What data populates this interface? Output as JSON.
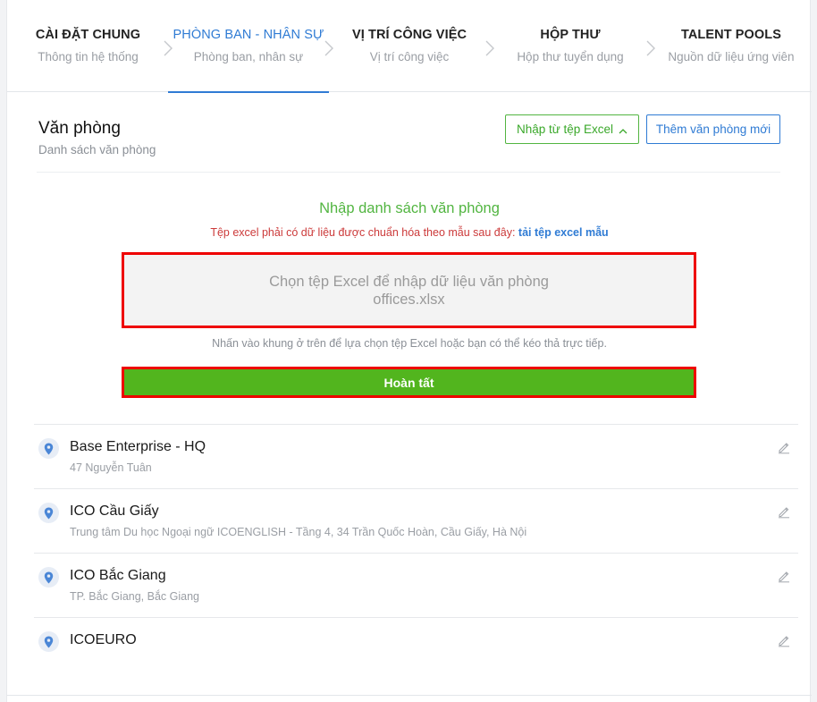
{
  "steps": [
    {
      "title": "CÀI ĐẶT CHUNG",
      "subtitle": "Thông tin hệ thống",
      "active": false
    },
    {
      "title": "PHÒNG BAN - NHÂN SỰ",
      "subtitle": "Phòng ban, nhân sự",
      "active": true
    },
    {
      "title": "VỊ TRÍ CÔNG VIỆC",
      "subtitle": "Vị trí công việc",
      "active": false
    },
    {
      "title": "HỘP THƯ",
      "subtitle": "Hộp thư tuyển dụng",
      "active": false
    },
    {
      "title": "TALENT POOLS",
      "subtitle": "Nguồn dữ liệu ứng viên",
      "active": false
    }
  ],
  "header": {
    "title": "Văn phòng",
    "subtitle": "Danh sách văn phòng",
    "import_label": "Nhập từ tệp Excel",
    "add_label": "Thêm văn phòng mới"
  },
  "import_panel": {
    "title": "Nhập danh sách văn phòng",
    "note": "Tệp excel phải có dữ liệu được chuẩn hóa theo mẫu sau đây:",
    "template_link": "tải tệp excel mẫu",
    "dropzone_text": "Chọn tệp Excel để nhập dữ liệu văn phòng",
    "file_name": "offices.xlsx",
    "hint": "Nhấn vào khung ở trên để lựa chọn tệp Excel hoặc bạn có thể kéo thả trực tiếp.",
    "done_label": "Hoàn tất"
  },
  "offices": [
    {
      "name": "Base Enterprise - HQ",
      "address": "47 Nguyễn Tuân"
    },
    {
      "name": "ICO Cầu Giấy",
      "address": "Trung tâm Du học Ngoại ngữ ICOENGLISH - Tầng 4, 34 Trần Quốc Hoàn, Cầu Giấy, Hà Nội"
    },
    {
      "name": "ICO Bắc Giang",
      "address": "TP. Bắc Giang, Bắc Giang"
    },
    {
      "name": "ICOEURO",
      "address": ""
    }
  ],
  "colors": {
    "accent_blue": "#2f7bd4",
    "accent_green": "#52b541",
    "highlight_red": "#e00000"
  }
}
